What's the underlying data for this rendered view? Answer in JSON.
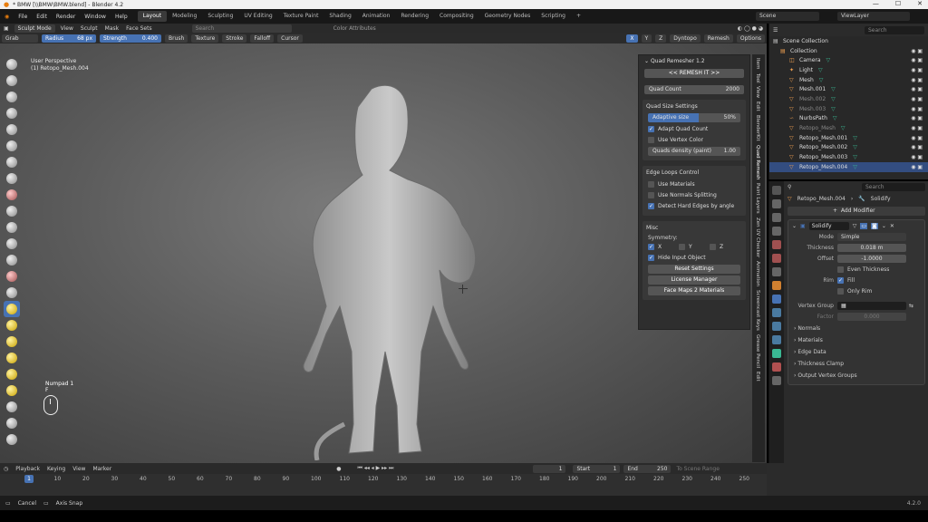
{
  "window": {
    "title": "* BMW [\\\\BMW\\BMW.blend] - Blender 4.2"
  },
  "menu": [
    "File",
    "Edit",
    "Render",
    "Window",
    "Help"
  ],
  "workspaces": [
    "Layout",
    "Modeling",
    "Sculpting",
    "UV Editing",
    "Texture Paint",
    "Shading",
    "Animation",
    "Rendering",
    "Compositing",
    "Geometry Nodes",
    "Scripting"
  ],
  "active_workspace": "Layout",
  "scene": {
    "name": "Scene",
    "view_layer": "ViewLayer"
  },
  "viewport_header": {
    "mode": "Sculpt Mode",
    "view": "View",
    "sculpt": "Sculpt",
    "mask": "Mask",
    "face_sets": "Face Sets",
    "search_placeholder": "Search",
    "color_attributes": "Color Attributes"
  },
  "tool_header": {
    "tool": "Grab",
    "radius_label": "Radius",
    "radius_value": "68 px",
    "strength_label": "Strength",
    "strength_value": "0.400",
    "brush": "Brush",
    "texture": "Texture",
    "stroke": "Stroke",
    "falloff": "Falloff",
    "cursor": "Cursor",
    "x": "X",
    "y": "Y",
    "z": "Z",
    "dyntopo": "Dyntopo",
    "remesh": "Remesh",
    "options": "Options"
  },
  "viewport": {
    "perspective": "User Perspective",
    "object": "(1) Retopo_Mesh.004",
    "numpad": "Numpad 1",
    "key": "F"
  },
  "quad_remesher": {
    "title": "Quad Remesher 1.2",
    "remesh_button": "<< REMESH IT >>",
    "quad_count_label": "Quad Count",
    "quad_count_value": "2000",
    "size_section": "Quad Size Settings",
    "adaptive_label": "Adaptive size",
    "adaptive_value": "50%",
    "adaptive_fraction": 0.5,
    "adapt_quad_count": "Adapt Quad Count",
    "use_vertex_color": "Use Vertex Color",
    "density_label": "Quads density (paint)",
    "density_value": "1.00",
    "edge_section": "Edge Loops Control",
    "use_materials": "Use Materials",
    "use_normals": "Use Normals Splitting",
    "detect_hard": "Detect Hard Edges by angle",
    "misc_section": "Misc",
    "symmetry": "Symmetry:",
    "sym_x": "X",
    "sym_y": "Y",
    "sym_z": "Z",
    "hide_input": "Hide Input Object",
    "reset": "Reset Settings",
    "license": "License Manager",
    "face_maps": "Face Maps 2 Materials"
  },
  "vertical_tabs": [
    "Item",
    "Tool",
    "View",
    "Edit",
    "BlenderKit",
    "Quad Remesh",
    "Paint Layers",
    "Zen UV Checker",
    "Animation",
    "Screencast Keys",
    "Grease Pencil",
    "Edit"
  ],
  "outliner": {
    "title": "Scene Collection",
    "search_placeholder": "Search",
    "rows": [
      {
        "label": "Collection",
        "indent": 0,
        "icon": "collection-icon"
      },
      {
        "label": "Camera",
        "indent": 1,
        "icon": "camera-icon"
      },
      {
        "label": "Light",
        "indent": 1,
        "icon": "light-icon"
      },
      {
        "label": "Mesh",
        "indent": 1,
        "icon": "mesh-icon"
      },
      {
        "label": "Mesh.001",
        "indent": 1,
        "icon": "mesh-icon"
      },
      {
        "label": "Mesh.002",
        "indent": 1,
        "icon": "mesh-icon",
        "dim": true
      },
      {
        "label": "Mesh.003",
        "indent": 1,
        "icon": "mesh-icon",
        "dim": true
      },
      {
        "label": "NurbsPath",
        "indent": 1,
        "icon": "curve-icon"
      },
      {
        "label": "Retopo_Mesh",
        "indent": 1,
        "icon": "mesh-icon",
        "dim": true
      },
      {
        "label": "Retopo_Mesh.001",
        "indent": 1,
        "icon": "mesh-icon"
      },
      {
        "label": "Retopo_Mesh.002",
        "indent": 1,
        "icon": "mesh-icon"
      },
      {
        "label": "Retopo_Mesh.003",
        "indent": 1,
        "icon": "mesh-icon"
      },
      {
        "label": "Retopo_Mesh.004",
        "indent": 1,
        "icon": "mesh-icon",
        "selected": true
      }
    ]
  },
  "properties": {
    "search_placeholder": "Search",
    "object": "Retopo_Mesh.004",
    "modifier_tab": "Solidify",
    "add_modifier": "Add Modifier",
    "mod_name": "Solidify",
    "mode_label": "Mode",
    "mode_value": "Simple",
    "thickness_label": "Thickness",
    "thickness_value": "0.018 m",
    "offset_label": "Offset",
    "offset_value": "-1.0000",
    "even_thickness": "Even Thickness",
    "rim_label": "Rim",
    "fill": "Fill",
    "only_rim": "Only Rim",
    "vertex_group_label": "Vertex Group",
    "factor_label": "Factor",
    "factor_value": "0.000",
    "subpanels": [
      "Normals",
      "Materials",
      "Edge Data",
      "Thickness Clamp",
      "Output Vertex Groups"
    ]
  },
  "timeline": {
    "playback": "Playback",
    "keying": "Keying",
    "view": "View",
    "marker": "Marker",
    "current_frame": "1",
    "start_label": "Start",
    "start": "1",
    "end_label": "End",
    "end": "250",
    "to_scene_range": "To Scene Range",
    "ticks": [
      "1",
      "10",
      "20",
      "30",
      "40",
      "50",
      "60",
      "70",
      "80",
      "90",
      "100",
      "110",
      "120",
      "130",
      "140",
      "150",
      "160",
      "170",
      "180",
      "190",
      "200",
      "210",
      "220",
      "230",
      "240",
      "250"
    ]
  },
  "status": {
    "cancel": "Cancel",
    "axis_snap": "Axis Snap",
    "version": "4.2.0"
  }
}
